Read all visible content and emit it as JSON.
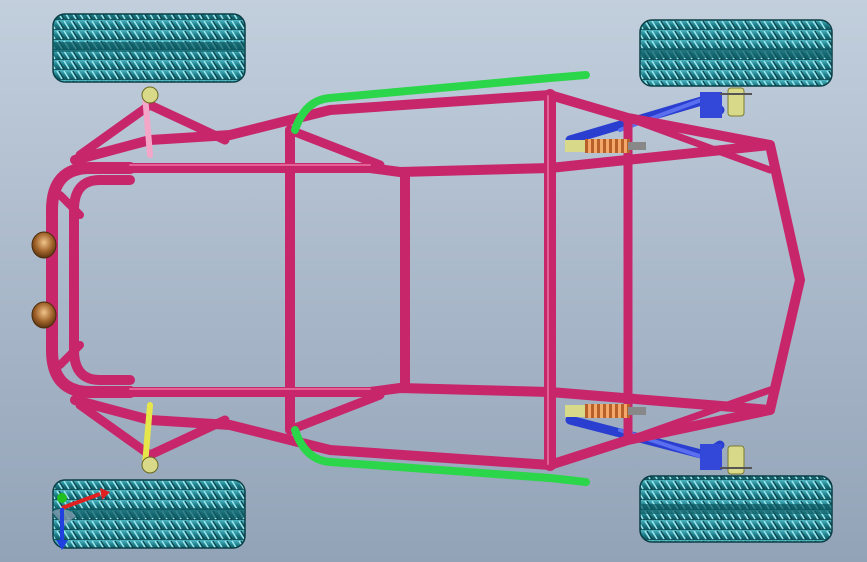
{
  "viewport": {
    "background_top": "#c2cfdd",
    "background_bottom": "#93a3b7"
  },
  "model": {
    "colors": {
      "frame": "#c8266a",
      "frame_highlight": "#f07aa8",
      "roll_bar": "#2bd64a",
      "a_arm": "#2a3fd0",
      "tire": "#1d8a94",
      "tire_highlight": "#6fd3dc",
      "spring": "#e0843a",
      "shock_mount": "#d9d98a",
      "headlight": "#a0622a",
      "tie_rod": "#e6e64a",
      "steering_link": "#f3a6c8"
    },
    "parts": {
      "tires": [
        "front-left-tire",
        "front-right-tire",
        "rear-left-tire",
        "rear-right-tire"
      ],
      "headlights": 2,
      "shocks": 2
    }
  },
  "triad": {
    "axes": [
      {
        "name": "x",
        "color": "#e02020"
      },
      {
        "name": "y",
        "color": "#20c020"
      },
      {
        "name": "z",
        "color": "#2040e0"
      }
    ]
  }
}
